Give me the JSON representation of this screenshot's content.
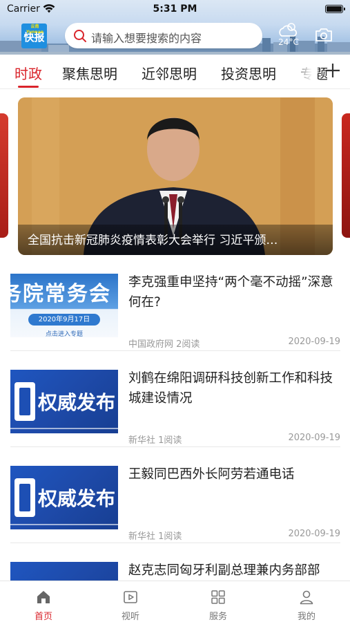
{
  "status_bar": {
    "carrier": "Carrier",
    "time": "5:31 PM"
  },
  "header": {
    "logo_text": "快报",
    "logo_small": "云南 Yunnan",
    "search_placeholder": "请输入想要搜索的内容",
    "weather_temp": "24°C"
  },
  "tabs": [
    {
      "label": "时政",
      "active": true
    },
    {
      "label": "聚焦思明",
      "active": false
    },
    {
      "label": "近邻思明",
      "active": false
    },
    {
      "label": "投资思明",
      "active": false
    },
    {
      "label": "专题",
      "active": false
    }
  ],
  "banner": {
    "caption": "全国抗击新冠肺炎疫情表彰大会举行 习近平颁…"
  },
  "news": [
    {
      "headline": "李克强重申坚持“两个毫不动摇”深意何在?",
      "source": "中国政府网",
      "reads": "2阅读",
      "date": "2020-09-19",
      "thumb": {
        "type": "meeting",
        "big_text": "务院常务会",
        "pill_text": "2020年9月17日",
        "link_text": "点击进入专题"
      }
    },
    {
      "headline": "刘鹤在绵阳调研科技创新工作和科技城建设情况",
      "source": "新华社",
      "reads": "1阅读",
      "date": "2020-09-19",
      "thumb": {
        "type": "authority",
        "text": "权威发布"
      }
    },
    {
      "headline": "王毅同巴西外长阿劳若通电话",
      "source": "新华社",
      "reads": "1阅读",
      "date": "2020-09-19",
      "thumb": {
        "type": "authority",
        "text": "权威发布"
      }
    },
    {
      "headline": "赵克志同匈牙利副总理兼内务部部",
      "source": "",
      "reads": "",
      "date": "",
      "thumb": {
        "type": "authority",
        "text": ""
      }
    }
  ],
  "tabbar": [
    {
      "label": "首页",
      "icon": "home-icon",
      "active": true
    },
    {
      "label": "视听",
      "icon": "video-icon",
      "active": false
    },
    {
      "label": "服务",
      "icon": "grid-icon",
      "active": false
    },
    {
      "label": "我的",
      "icon": "profile-icon",
      "active": false
    }
  ],
  "colors": {
    "accent": "#d9242b",
    "logo_blue": "#1f8fe0",
    "muted": "#999999"
  }
}
